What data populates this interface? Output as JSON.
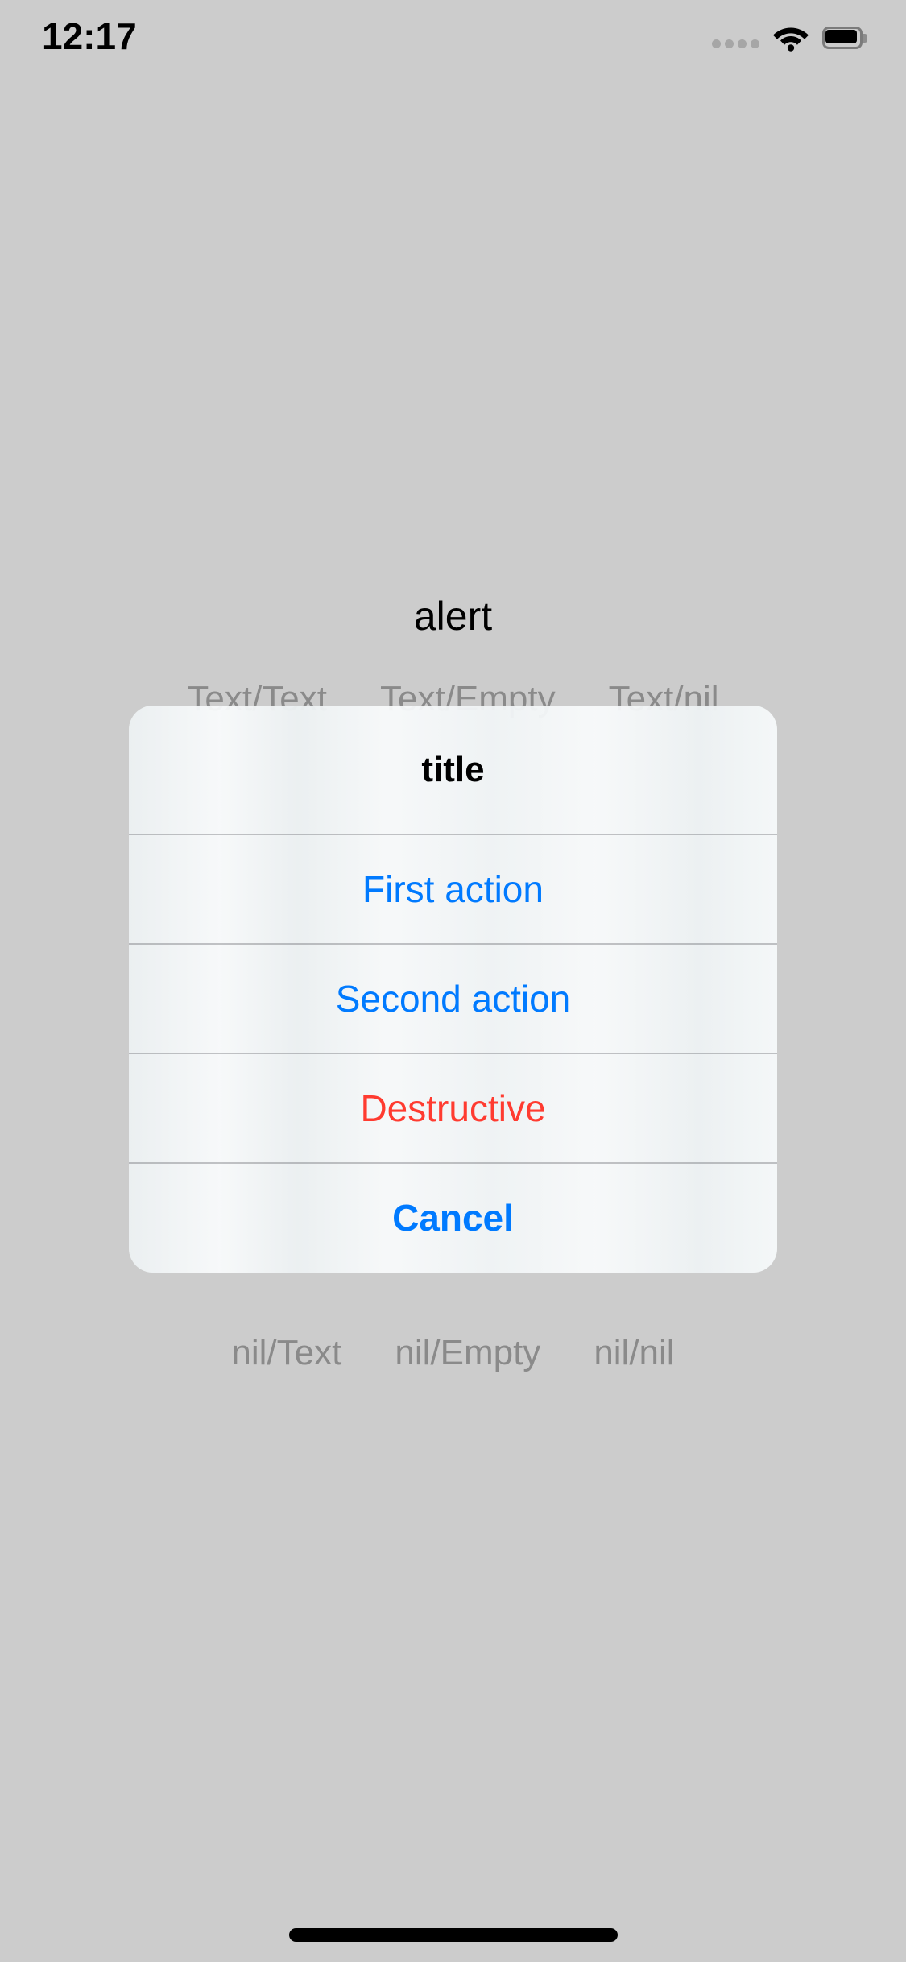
{
  "status_bar": {
    "time": "12:17",
    "cellular_icon": "cellular-signal-dots-icon",
    "cellular_dots": 4,
    "wifi_icon": "wifi-icon",
    "battery_icon": "battery-full-icon"
  },
  "page": {
    "title": "alert"
  },
  "label_rows": {
    "top": [
      {
        "label": "Text/Text"
      },
      {
        "label": "Text/Empty"
      },
      {
        "label": "Text/nil"
      }
    ],
    "bottom": [
      {
        "label": "nil/Text"
      },
      {
        "label": "nil/Empty"
      },
      {
        "label": "nil/nil"
      }
    ]
  },
  "alert": {
    "title": "title",
    "actions": [
      {
        "label": "First action",
        "style": "default"
      },
      {
        "label": "Second action",
        "style": "default"
      },
      {
        "label": "Destructive",
        "style": "destructive"
      },
      {
        "label": "Cancel",
        "style": "cancel"
      }
    ]
  },
  "home_indicator": {
    "name": "home-indicator"
  },
  "colors": {
    "background": "#cccccc",
    "accent_blue": "#007aff",
    "destructive_red": "#ff3b30",
    "label_gray": "#8a8a8a",
    "dialog_surface": "#f9fbfc",
    "separator": "rgba(60,60,67,0.29)",
    "text_primary": "#000000"
  }
}
